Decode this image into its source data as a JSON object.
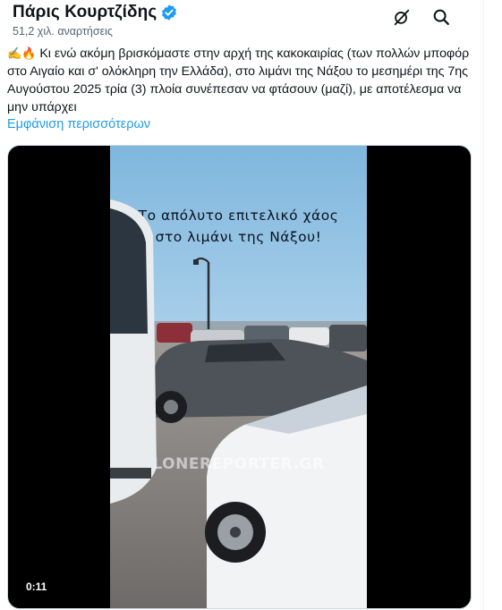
{
  "author": {
    "name": "Πάρις Κουρτζίδης",
    "views": "51,2 χιλ. αναρτήσεις"
  },
  "icons": {
    "verified": "verified-badge-icon",
    "grok": "grok-icon",
    "search": "search-icon"
  },
  "tweet": {
    "emoji": "✍️🔥",
    "text": " Κι ενώ ακόμη βρισκόμαστε στην αρχή της κακοκαιρίας (των πολλών μποφόρ στο Αιγαίο και σ' ολόκληρη την Ελλάδα), στο λιμάνι της Νάξου το μεσημέρι της 7ης Αυγούστου 2025 τρία (3) πλοία συνέπεσαν να φτάσουν (μαζί), με αποτέλεσμα να μην υπάρχει",
    "show_more": "Εμφάνιση περισσότερων"
  },
  "video": {
    "caption_line1": "Το απόλυτο επιτελικό χάος",
    "caption_line2": "στο λιμάνι της Νάξου!",
    "watermark": "LONEREPORTER.GR",
    "duration": "0:11"
  },
  "colors": {
    "accent": "#1d9bf0",
    "text": "#0f1419",
    "secondary": "#536471"
  }
}
